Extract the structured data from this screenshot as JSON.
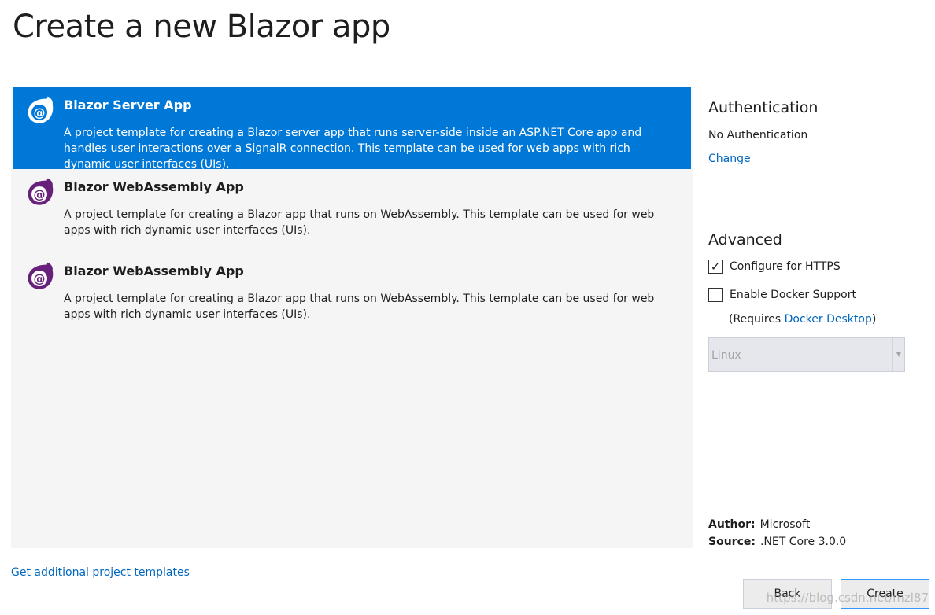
{
  "page": {
    "title": "Create a new Blazor app"
  },
  "templates": [
    {
      "name": "Blazor Server App",
      "description": "A project template for creating a Blazor server app that runs server-side inside an ASP.NET Core app and handles user interactions over a SignalR connection. This template can be used for web apps with rich dynamic user interfaces (UIs).",
      "selected": true,
      "icon": "blazor-icon"
    },
    {
      "name": "Blazor WebAssembly App",
      "description": "A project template for creating a Blazor app that runs on WebAssembly. This template can be used for web apps with rich dynamic user interfaces (UIs).",
      "selected": false,
      "icon": "blazor-icon"
    },
    {
      "name": "Blazor WebAssembly App",
      "description": "A project template for creating a Blazor app that runs on WebAssembly. This template can be used for web apps with rich dynamic user interfaces (UIs).",
      "selected": false,
      "icon": "blazor-icon"
    }
  ],
  "authentication": {
    "heading": "Authentication",
    "value": "No Authentication",
    "change_link": "Change"
  },
  "advanced": {
    "heading": "Advanced",
    "https_label": "Configure for HTTPS",
    "https_checked": true,
    "docker_label": "Enable Docker Support",
    "docker_checked": false,
    "requires_prefix": "(Requires ",
    "requires_link": "Docker Desktop",
    "requires_suffix": ")",
    "os_select": {
      "value": "Linux",
      "disabled": true
    }
  },
  "meta": {
    "author_label": "Author:",
    "author_value": "Microsoft",
    "source_label": "Source:",
    "source_value": ".NET Core 3.0.0"
  },
  "footer": {
    "additional_templates_link": "Get additional project templates",
    "back_label": "Back",
    "create_label": "Create"
  },
  "watermark": "https://blog.csdn.net/mzl87",
  "colors": {
    "accent": "#0078d7",
    "link": "#0066bf",
    "blazor_icon": "#68217a"
  }
}
